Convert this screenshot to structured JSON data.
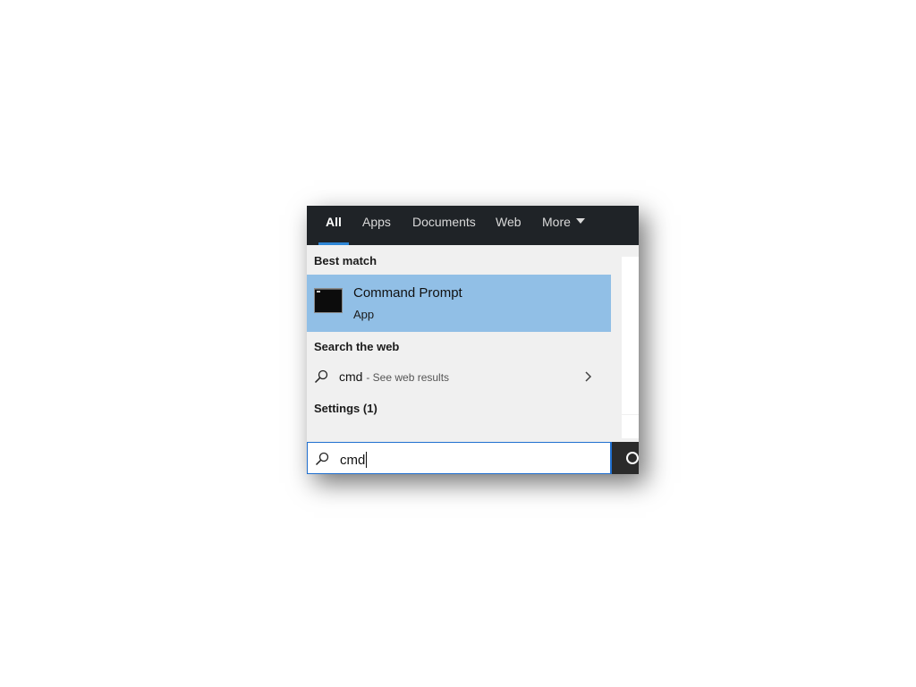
{
  "tabs": [
    {
      "label": "All",
      "active": true
    },
    {
      "label": "Apps"
    },
    {
      "label": "Documents"
    },
    {
      "label": "Web"
    },
    {
      "label": "More"
    }
  ],
  "best_match": {
    "header": "Best match",
    "title": "Command Prompt",
    "subtitle": "App",
    "icon": "command-prompt-icon"
  },
  "search_web": {
    "header": "Search the web",
    "query": "cmd",
    "hint": "- See web results",
    "icon": "search-icon"
  },
  "settings": {
    "header": "Settings (1)"
  },
  "search_box": {
    "value": "cmd",
    "icon": "search-icon"
  },
  "colors": {
    "tabbar_bg": "#1f2327",
    "accent": "#2e86d6",
    "selected_bg": "#91bfe6",
    "panel_bg": "#f0f0f0"
  }
}
